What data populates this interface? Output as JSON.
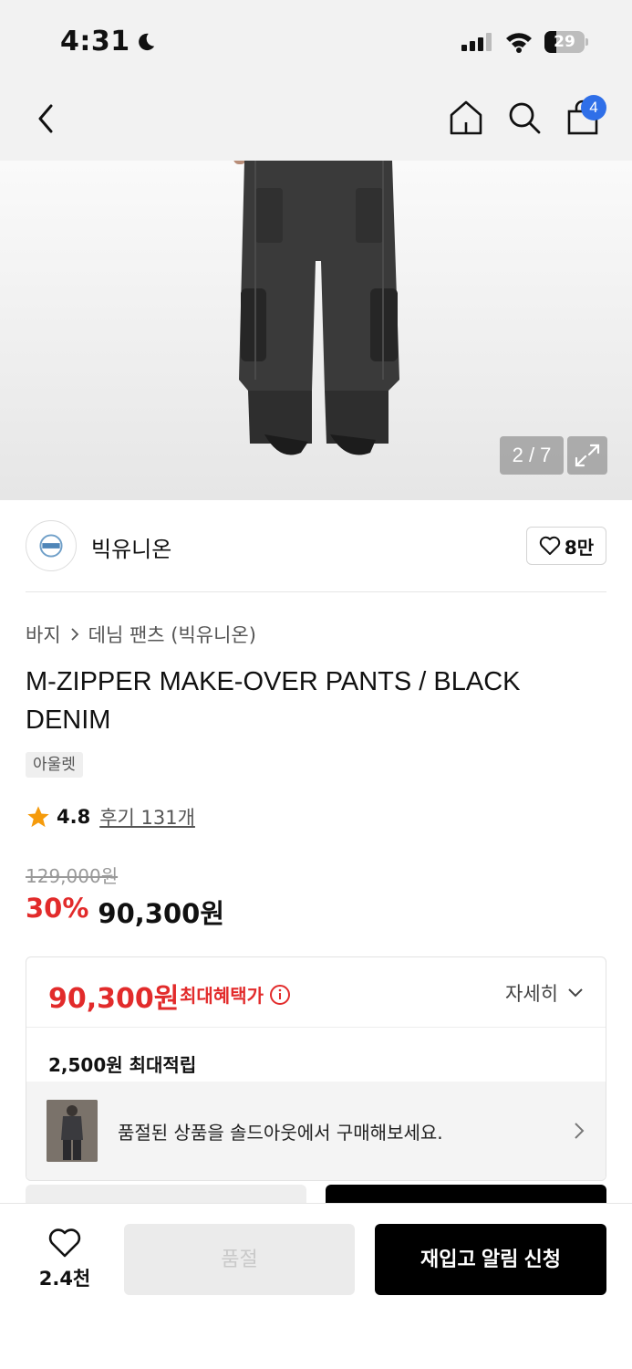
{
  "status_bar": {
    "time": "4:31",
    "battery": "29",
    "battery_level": 0.29
  },
  "nav": {
    "cart_count": "4"
  },
  "hero": {
    "image_counter": "2 / 7"
  },
  "brand": {
    "name": "빅유니온",
    "likes": "8만"
  },
  "breadcrumb": {
    "category": "바지",
    "subcategory": "데님 팬츠 (빅유니온)"
  },
  "product": {
    "title": "M-ZIPPER MAKE-OVER PANTS / BLACK DENIM",
    "tag": "아울렛",
    "rating": "4.8",
    "review_label": "후기 131개",
    "original_price": "129,000원",
    "discount": "30%",
    "price": "90,300원"
  },
  "benefit": {
    "max_price": "90,300원",
    "max_label": "최대혜택가",
    "detail_label": "자세히",
    "points": "2,500원 최대적립",
    "soldout_banner_text": "품절된 상품을 솔드아웃에서 구매해보세요."
  },
  "bottom_bar": {
    "wish_count": "2.4천",
    "soldout_label": "품절",
    "restock_label": "재입고 알림 신청"
  },
  "colors": {
    "accent_red": "#e22b2b",
    "badge_blue": "#2f6fe8",
    "primary_black": "#000000"
  },
  "icons": {
    "back": "chevron-left-icon",
    "home": "home-icon",
    "search": "search-icon",
    "cart": "shopping-bag-icon",
    "expand": "expand-icon",
    "heart": "heart-icon",
    "star": "star-icon",
    "info": "info-icon"
  }
}
